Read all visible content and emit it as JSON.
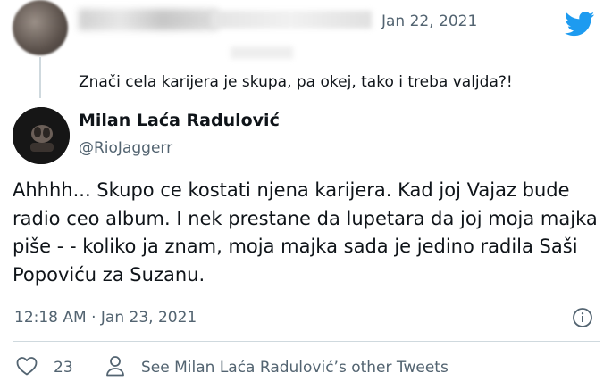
{
  "parent_tweet": {
    "date": "Jan 22, 2021",
    "text": "Znači cela karijera je skupa, pa okej, tako i treba valjda?!"
  },
  "tweet": {
    "author_name": "Milan Laća Radulović",
    "handle": "@RioJaggerr",
    "text": "Ahhhh... Skupo ce kostati njena karijera. Kad joj Vajaz bude radio ceo album. I nek prestane da lupetara da joj moja majka piše - - koliko ja znam, moja majka sada je jedino radila Saši Popoviću za Suzanu.",
    "timestamp": "12:18 AM · Jan 23, 2021"
  },
  "actions": {
    "like_count": "23",
    "see_more_label": "See Milan Laća Radulović’s other Tweets"
  },
  "icons": {
    "brand": "twitter-bird-icon",
    "info": "info-icon",
    "like": "heart-icon",
    "profile": "person-icon"
  },
  "colors": {
    "twitter_blue": "#1d9bf0",
    "secondary_text": "#536471",
    "primary_text": "#0f1419",
    "divider": "#cfd9de"
  }
}
